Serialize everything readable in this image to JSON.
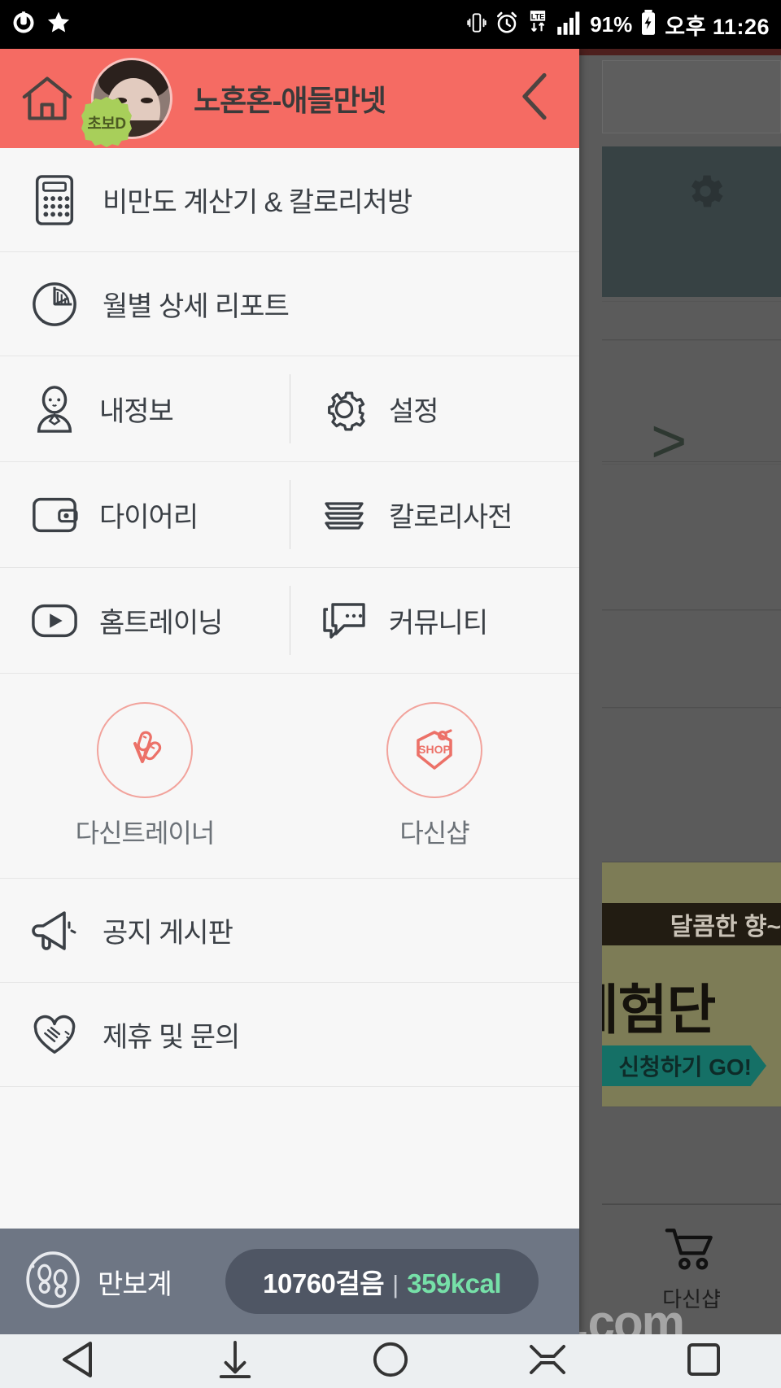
{
  "status_bar": {
    "left_icons": [
      "usb-icon",
      "star-icon"
    ],
    "right_icons": [
      "vibrate-icon",
      "alarm-icon",
      "lte-icon",
      "signal-icon",
      "battery-charging-icon"
    ],
    "battery_percent": "91%",
    "time": "오후 11:26"
  },
  "drawer": {
    "header": {
      "home_icon": "home-icon",
      "badge_label": "초보D",
      "user_name": "노혼혼-애들만넷",
      "back_icon": "chevron-left-icon"
    },
    "full_rows": [
      {
        "icon": "calculator-icon",
        "label": "비만도 계산기 & 칼로리처방"
      },
      {
        "icon": "pie-chart-icon",
        "label": "월별 상세 리포트"
      }
    ],
    "split_rows": [
      {
        "left": {
          "icon": "person-icon",
          "label": "내정보"
        },
        "right": {
          "icon": "gear-icon",
          "label": "설정"
        }
      },
      {
        "left": {
          "icon": "wallet-icon",
          "label": "다이어리"
        },
        "right": {
          "icon": "book-stack-icon",
          "label": "칼로리사전"
        }
      },
      {
        "left": {
          "icon": "play-video-icon",
          "label": "홈트레이닝"
        },
        "right": {
          "icon": "chat-bubble-icon",
          "label": "커뮤니티"
        }
      }
    ],
    "promo": [
      {
        "icon": "dumbbell-trainer-icon",
        "label": "다신트레이너"
      },
      {
        "icon": "shop-tag-icon",
        "badge_text": "SHOP",
        "label": "다신샵"
      }
    ],
    "bottom_rows": [
      {
        "icon": "megaphone-icon",
        "label": "공지 게시판"
      },
      {
        "icon": "handshake-heart-icon",
        "label": "제휴 및 문의"
      }
    ],
    "pedometer": {
      "icon": "footprints-icon",
      "label": "만보계",
      "steps": "10760걸음",
      "separator": "|",
      "calories": "359kcal"
    }
  },
  "background_app": {
    "gear_icon": "gear-icon",
    "chevron_icon": "chevron-right-icon",
    "ad_top_text": "달콤한 향~",
    "ad_headline": "체험단",
    "ad_cta": "신청하기 GO!",
    "tab_icon": "cart-icon",
    "tab_label": "다신샵"
  },
  "watermark": "dietshin.com",
  "nav_bar": {
    "items": [
      "back-triangle-icon",
      "download-arrow-icon",
      "home-circle-icon",
      "collapse-icon",
      "recents-square-icon"
    ]
  },
  "colors": {
    "accent": "#f56b63",
    "promo_outline": "#f2a39c",
    "pedometer_bg": "#6e7684",
    "kcal_green": "#76e0a8",
    "badge_green": "#a8cf5a"
  }
}
